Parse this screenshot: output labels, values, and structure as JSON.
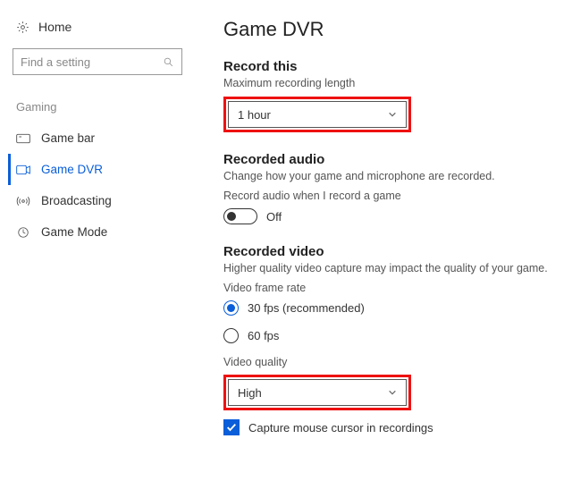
{
  "sidebar": {
    "home": "Home",
    "search_placeholder": "Find a setting",
    "category": "Gaming",
    "items": [
      {
        "label": "Game bar"
      },
      {
        "label": "Game DVR"
      },
      {
        "label": "Broadcasting"
      },
      {
        "label": "Game Mode"
      }
    ]
  },
  "main": {
    "title": "Game DVR",
    "record_this": {
      "heading": "Record this",
      "label": "Maximum recording length",
      "value": "1 hour"
    },
    "recorded_audio": {
      "heading": "Recorded audio",
      "sub": "Change how your game and microphone are recorded.",
      "toggle_label": "Record audio when I record a game",
      "toggle_state": "Off"
    },
    "recorded_video": {
      "heading": "Recorded video",
      "sub": "Higher quality video capture may impact the quality of your game.",
      "frame_rate_label": "Video frame rate",
      "fps30": "30 fps (recommended)",
      "fps60": "60 fps",
      "quality_label": "Video quality",
      "quality_value": "High",
      "capture_cursor": "Capture mouse cursor in recordings"
    }
  }
}
